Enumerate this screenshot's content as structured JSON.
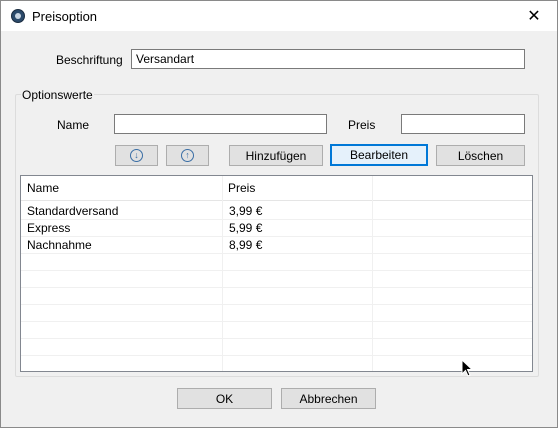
{
  "window": {
    "title": "Preisoption"
  },
  "form": {
    "beschriftung_label": "Beschriftung",
    "beschriftung_value": "Versandart"
  },
  "group": {
    "title": "Optionswerte",
    "name_label": "Name",
    "name_value": "",
    "preis_label": "Preis",
    "preis_value": ""
  },
  "buttons": {
    "add": "Hinzufügen",
    "edit": "Bearbeiten",
    "delete": "Löschen",
    "ok": "OK",
    "cancel": "Abbrechen",
    "move_down_icon": "arrow-down-circle-icon",
    "move_up_icon": "arrow-up-circle-icon"
  },
  "list": {
    "columns": [
      "Name",
      "Preis"
    ],
    "rows": [
      [
        "Standardversand",
        "3,99 €"
      ],
      [
        "Express",
        "5,99 €"
      ],
      [
        "Nachnahme",
        "8,99 €"
      ]
    ]
  },
  "colors": {
    "accent": "#0078d7",
    "window_bg": "#f0f0f0",
    "arrow_icon": "#3a6ea5"
  }
}
